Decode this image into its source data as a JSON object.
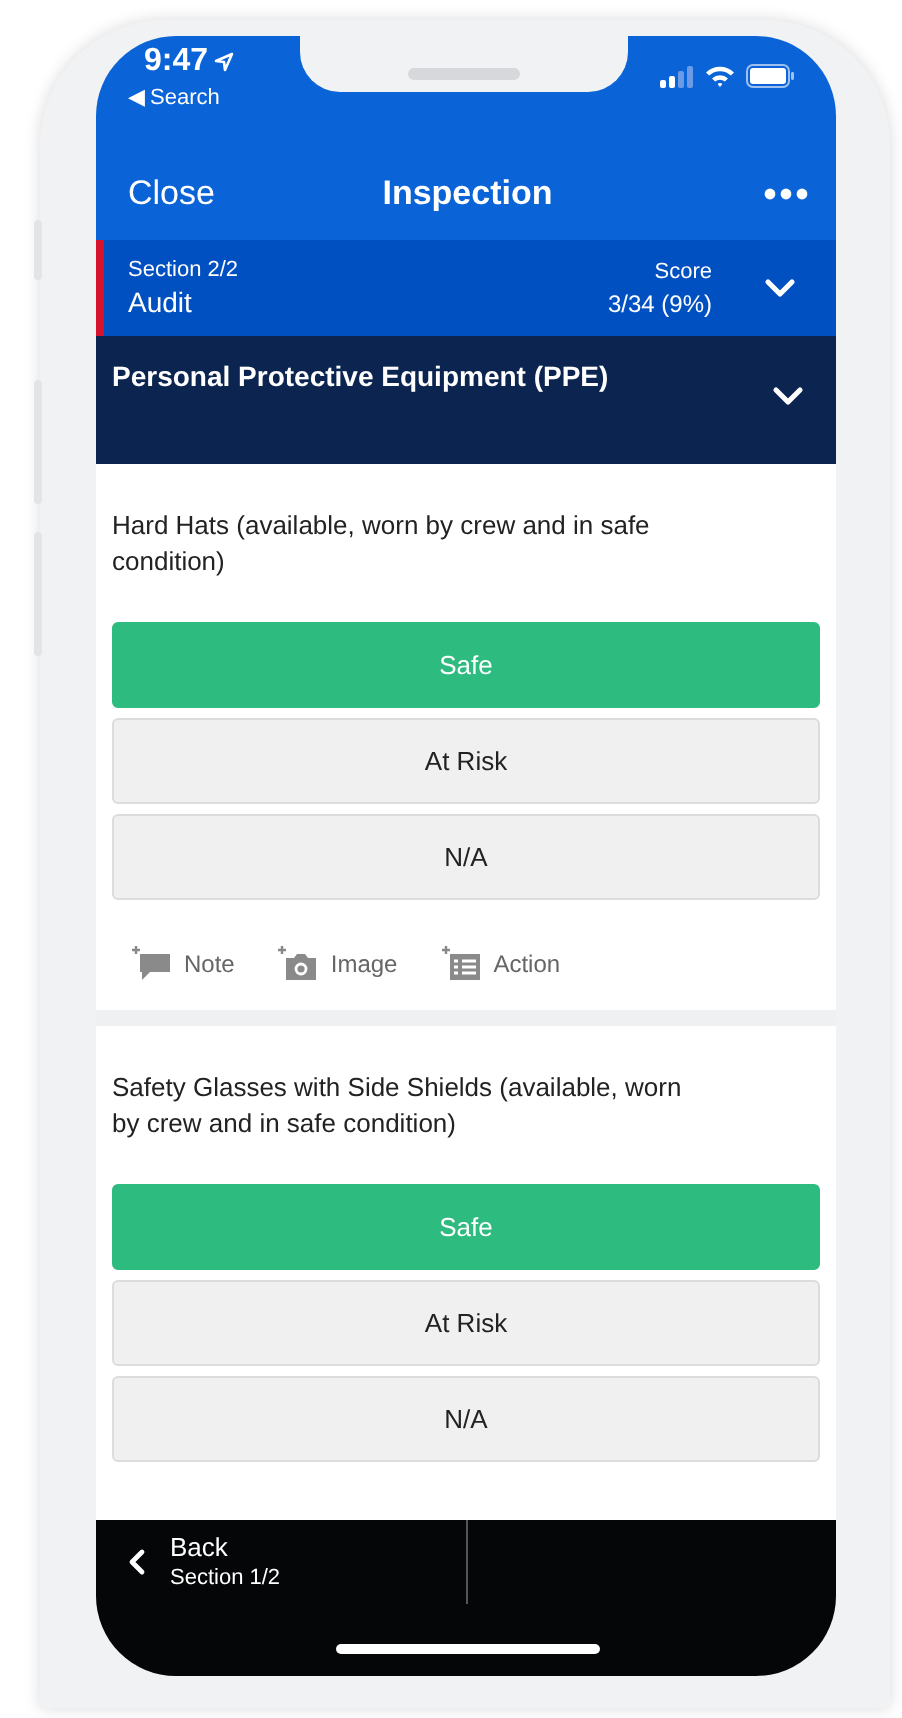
{
  "status_bar": {
    "time": "9:47",
    "back_link": "◀ Search"
  },
  "nav": {
    "left": "Close",
    "title": "Inspection"
  },
  "section": {
    "label": "Section 2/2",
    "name": "Audit",
    "score_label": "Score",
    "score": "3/34 (9%)"
  },
  "category": {
    "title": "Personal Protective Equipment (PPE)"
  },
  "questions": [
    {
      "text": "Hard Hats (available, worn by crew and in safe condition)",
      "options": [
        {
          "label": "Safe",
          "selected": true
        },
        {
          "label": "At Risk",
          "selected": false
        },
        {
          "label": "N/A",
          "selected": false
        }
      ],
      "actions": [
        {
          "label": "Note",
          "kind": "note"
        },
        {
          "label": "Image",
          "kind": "image"
        },
        {
          "label": "Action",
          "kind": "action"
        }
      ]
    },
    {
      "text": "Safety Glasses with Side Shields (available, worn by crew and in safe condition)",
      "options": [
        {
          "label": "Safe",
          "selected": true
        },
        {
          "label": "At Risk",
          "selected": false
        },
        {
          "label": "N/A",
          "selected": false
        }
      ]
    }
  ],
  "footer": {
    "back": "Back",
    "subtitle": "Section 1/2"
  }
}
